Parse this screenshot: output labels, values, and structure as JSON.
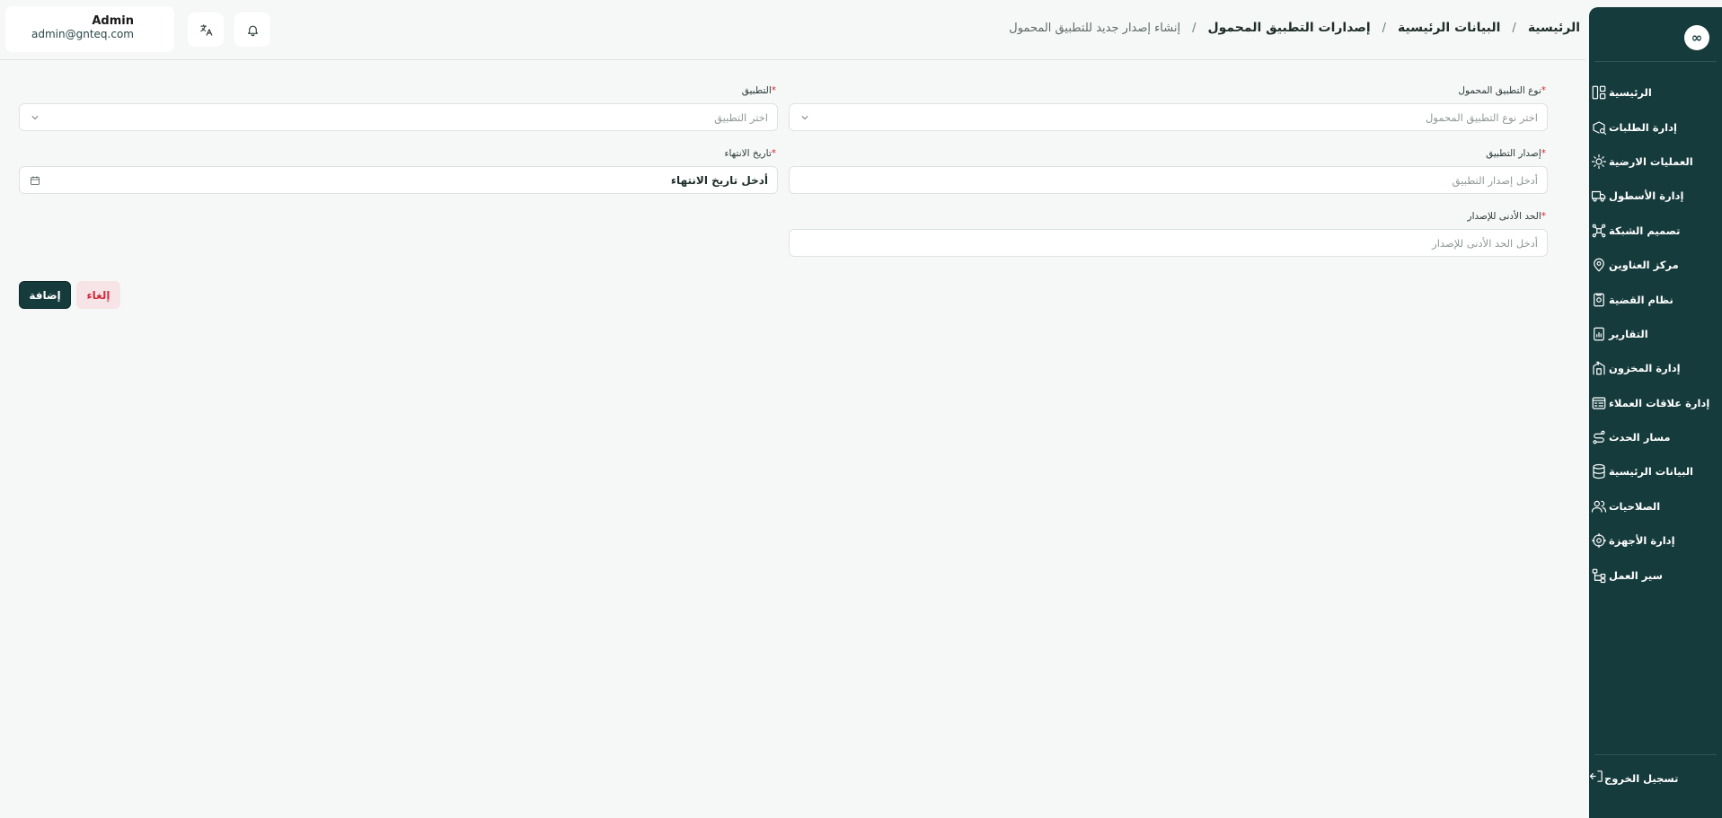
{
  "sidebar": {
    "logo": "∞",
    "items": [
      {
        "label": "الرئيسية",
        "icon": "layout-dashboard-icon"
      },
      {
        "label": "إدارة الطلبات",
        "icon": "package-search-icon"
      },
      {
        "label": "العمليات الارضية",
        "icon": "ground-operations-icon"
      },
      {
        "label": "إدارة الأسطول",
        "icon": "truck-icon"
      },
      {
        "label": "تصميم الشبكة",
        "icon": "network-icon"
      },
      {
        "label": "مركز العناوين",
        "icon": "map-pin-icon"
      },
      {
        "label": "نظام القضية",
        "icon": "case-file-icon"
      },
      {
        "label": "التقارير",
        "icon": "report-icon"
      },
      {
        "label": "إدارة المخزون",
        "icon": "warehouse-icon"
      },
      {
        "label": "إدارة علاقات العملاء",
        "icon": "crm-icon"
      },
      {
        "label": "مسار الحدث",
        "icon": "route-icon"
      },
      {
        "label": "البيانات الرئيسية",
        "icon": "database-icon"
      },
      {
        "label": "الصلاحيات",
        "icon": "users-icon"
      },
      {
        "label": "إدارة الأجهزة",
        "icon": "device-settings-icon"
      },
      {
        "label": "سير العمل",
        "icon": "workflow-icon"
      }
    ],
    "logout_label": "تسجيل الخروج"
  },
  "header": {
    "breadcrumb": [
      "الرئيسية",
      "البيانات الرئيسية",
      "إصدارات التطبيق المحمول",
      "إنشاء إصدار جديد للتطبيق المحمول"
    ],
    "user": {
      "name": "Admin",
      "email": "admin@gnteq.com"
    }
  },
  "form": {
    "mobile_app_type": {
      "label": "نوع التطبيق المحمول",
      "placeholder": "اختر نوع التطبيق المحمول",
      "required": true
    },
    "application": {
      "label": "التطبيق",
      "placeholder": "اختر التطبيق",
      "required": true
    },
    "app_version": {
      "label": "إصدار التطبيق",
      "placeholder": "أدخل إصدار التطبيق",
      "required": true
    },
    "expiry_date": {
      "label": "تاريخ الانتهاء",
      "placeholder": "أدخل تاريخ الانتهاء",
      "required": true
    },
    "min_version": {
      "label": "الحد الأدنى للإصدار",
      "placeholder": "أدخل الحد الأدنى للإصدار",
      "required": true
    },
    "add_label": "إضافة",
    "cancel_label": "إلغاء"
  },
  "colors": {
    "primary": "#163b3c",
    "danger": "#d42b3c",
    "background": "#f6f8f7"
  }
}
